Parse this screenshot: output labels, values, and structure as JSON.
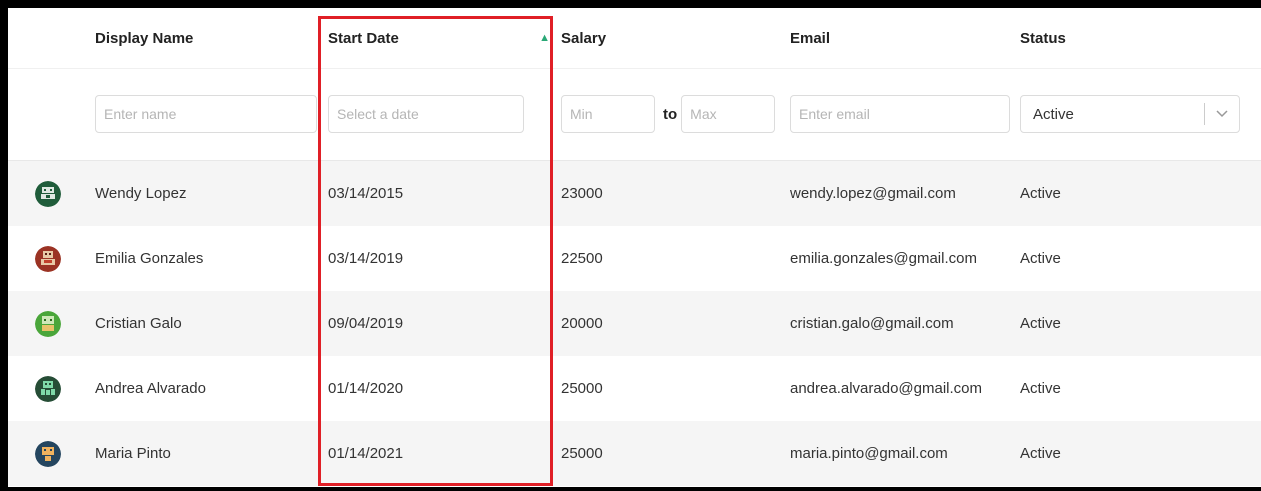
{
  "columns": {
    "display_name": "Display Name",
    "start_date": "Start Date",
    "salary": "Salary",
    "email": "Email",
    "status": "Status"
  },
  "sort": {
    "column": "Start Date",
    "direction": "ascending",
    "icon": "sort-ascending-triangle",
    "color": "#2aa876"
  },
  "filters": {
    "name_placeholder": "Enter name",
    "date_placeholder": "Select a date",
    "salary_min_placeholder": "Min",
    "salary_to_label": "to",
    "salary_max_placeholder": "Max",
    "email_placeholder": "Enter email",
    "status_selected": "Active"
  },
  "rows": [
    {
      "avatar_icon": "pixel-avatar-green",
      "avatar_color": "#2e7d4f",
      "name": "Wendy Lopez",
      "start_date": "03/14/2015",
      "salary": "23000",
      "email": "wendy.lopez@gmail.com",
      "status": "Active"
    },
    {
      "avatar_icon": "pixel-avatar-red",
      "avatar_color": "#a33a2a",
      "name": "Emilia Gonzales",
      "start_date": "03/14/2019",
      "salary": "22500",
      "email": "emilia.gonzales@gmail.com",
      "status": "Active"
    },
    {
      "avatar_icon": "pixel-avatar-lime",
      "avatar_color": "#4caf3c",
      "name": "Cristian Galo",
      "start_date": "09/04/2019",
      "salary": "20000",
      "email": "cristian.galo@gmail.com",
      "status": "Active"
    },
    {
      "avatar_icon": "pixel-avatar-teal",
      "avatar_color": "#2b6b4a",
      "name": "Andrea Alvarado",
      "start_date": "01/14/2020",
      "salary": "25000",
      "email": "andrea.alvarado@gmail.com",
      "status": "Active"
    },
    {
      "avatar_icon": "pixel-avatar-blue",
      "avatar_color": "#2d4f6e",
      "name": "Maria Pinto",
      "start_date": "01/14/2021",
      "salary": "25000",
      "email": "maria.pinto@gmail.com",
      "status": "Active"
    }
  ],
  "highlight": {
    "target": "Start Date",
    "color": "#e01f26"
  }
}
